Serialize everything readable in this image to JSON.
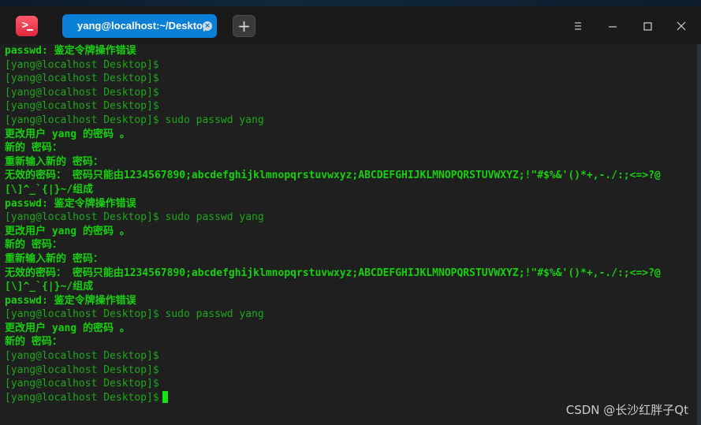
{
  "window": {
    "tab_title": "yang@localhost:~/Desktop",
    "tab_close_glyph": "×",
    "add_tab_glyph": "+",
    "app_icon_glyph": ">"
  },
  "terminal": {
    "lines": [
      {
        "text": "passwd: 鉴定令牌操作错误",
        "kind": "out"
      },
      {
        "text": "[yang@localhost Desktop]$",
        "kind": "prompt"
      },
      {
        "text": "[yang@localhost Desktop]$",
        "kind": "prompt"
      },
      {
        "text": "[yang@localhost Desktop]$",
        "kind": "prompt"
      },
      {
        "text": "[yang@localhost Desktop]$",
        "kind": "prompt"
      },
      {
        "text": "[yang@localhost Desktop]$ sudo passwd yang",
        "kind": "prompt"
      },
      {
        "text": "更改用户 yang 的密码 。",
        "kind": "out"
      },
      {
        "text": "新的 密码：",
        "kind": "out"
      },
      {
        "text": "重新输入新的 密码：",
        "kind": "out"
      },
      {
        "text": "无效的密码： 密码只能由1234567890;abcdefghijklmnopqrstuvwxyz;ABCDEFGHIJKLMNOPQRSTUVWXYZ;!\"#$%&'()*+,-./:;<=>?@",
        "kind": "out"
      },
      {
        "text": "[\\]^_`{|}~/组成",
        "kind": "out"
      },
      {
        "text": "passwd: 鉴定令牌操作错误",
        "kind": "out"
      },
      {
        "text": "[yang@localhost Desktop]$ sudo passwd yang",
        "kind": "prompt"
      },
      {
        "text": "更改用户 yang 的密码 。",
        "kind": "out"
      },
      {
        "text": "新的 密码：",
        "kind": "out"
      },
      {
        "text": "重新输入新的 密码：",
        "kind": "out"
      },
      {
        "text": "无效的密码： 密码只能由1234567890;abcdefghijklmnopqrstuvwxyz;ABCDEFGHIJKLMNOPQRSTUVWXYZ;!\"#$%&'()*+,-./:;<=>?@",
        "kind": "out"
      },
      {
        "text": "[\\]^_`{|}~/组成",
        "kind": "out"
      },
      {
        "text": "passwd: 鉴定令牌操作错误",
        "kind": "out"
      },
      {
        "text": "[yang@localhost Desktop]$ sudo passwd yang",
        "kind": "prompt"
      },
      {
        "text": "更改用户 yang 的密码 。",
        "kind": "out"
      },
      {
        "text": "新的 密码：",
        "kind": "out"
      },
      {
        "text": "[yang@localhost Desktop]$",
        "kind": "prompt"
      },
      {
        "text": "[yang@localhost Desktop]$",
        "kind": "prompt"
      },
      {
        "text": "[yang@localhost Desktop]$",
        "kind": "prompt"
      },
      {
        "text": "[yang@localhost Desktop]$",
        "kind": "prompt"
      }
    ]
  },
  "watermark": "CSDN @长沙红胖子Qt",
  "colors": {
    "terminal_text": "#16c60c",
    "tab_accent": "#0a7fd6",
    "app_icon": "#e0283e",
    "background": "#1f1f1f"
  }
}
